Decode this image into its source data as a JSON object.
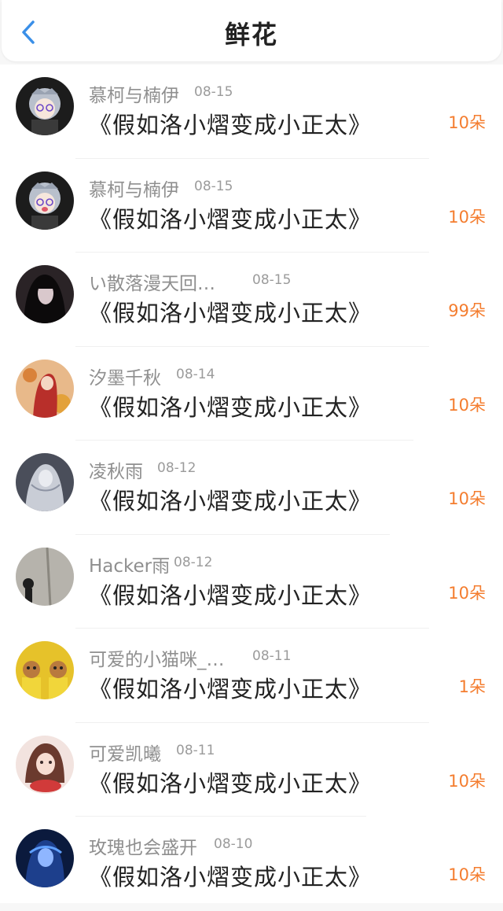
{
  "header": {
    "title": "鲜花",
    "back_icon": "chevron-left-icon",
    "accent_color": "#3a8fe8"
  },
  "items": [
    {
      "name": "慕柯与楠伊",
      "date": "08-15",
      "book": "《假如洛小熠变成小正太》",
      "count": "10朵"
    },
    {
      "name": "慕柯与楠伊",
      "date": "08-15",
      "book": "《假如洛小熠变成小正太》",
      "count": "10朵"
    },
    {
      "name": "い散落漫天回…",
      "date": "08-15",
      "book": "《假如洛小熠变成小正太》",
      "count": "99朵"
    },
    {
      "name": "汐墨千秋",
      "date": "08-14",
      "book": "《假如洛小熠变成小正太》",
      "count": "10朵"
    },
    {
      "name": "凌秋雨",
      "date": "08-12",
      "book": "《假如洛小熠变成小正太》",
      "count": "10朵"
    },
    {
      "name": "Hacker雨",
      "date": "08-12",
      "book": "《假如洛小熠变成小正太》",
      "count": "10朵"
    },
    {
      "name": "可爱的小猫咪_…",
      "date": "08-11",
      "book": "《假如洛小熠变成小正太》",
      "count": "1朵"
    },
    {
      "name": "可爱凯曦",
      "date": "08-11",
      "book": "《假如洛小熠变成小正太》",
      "count": "10朵"
    },
    {
      "name": "玫瑰也会盛开",
      "date": "08-10",
      "book": "《假如洛小熠变成小正太》",
      "count": "10朵"
    }
  ],
  "colors": {
    "count": "#f47d2f",
    "name": "#8f8f8f",
    "book": "#222222"
  }
}
